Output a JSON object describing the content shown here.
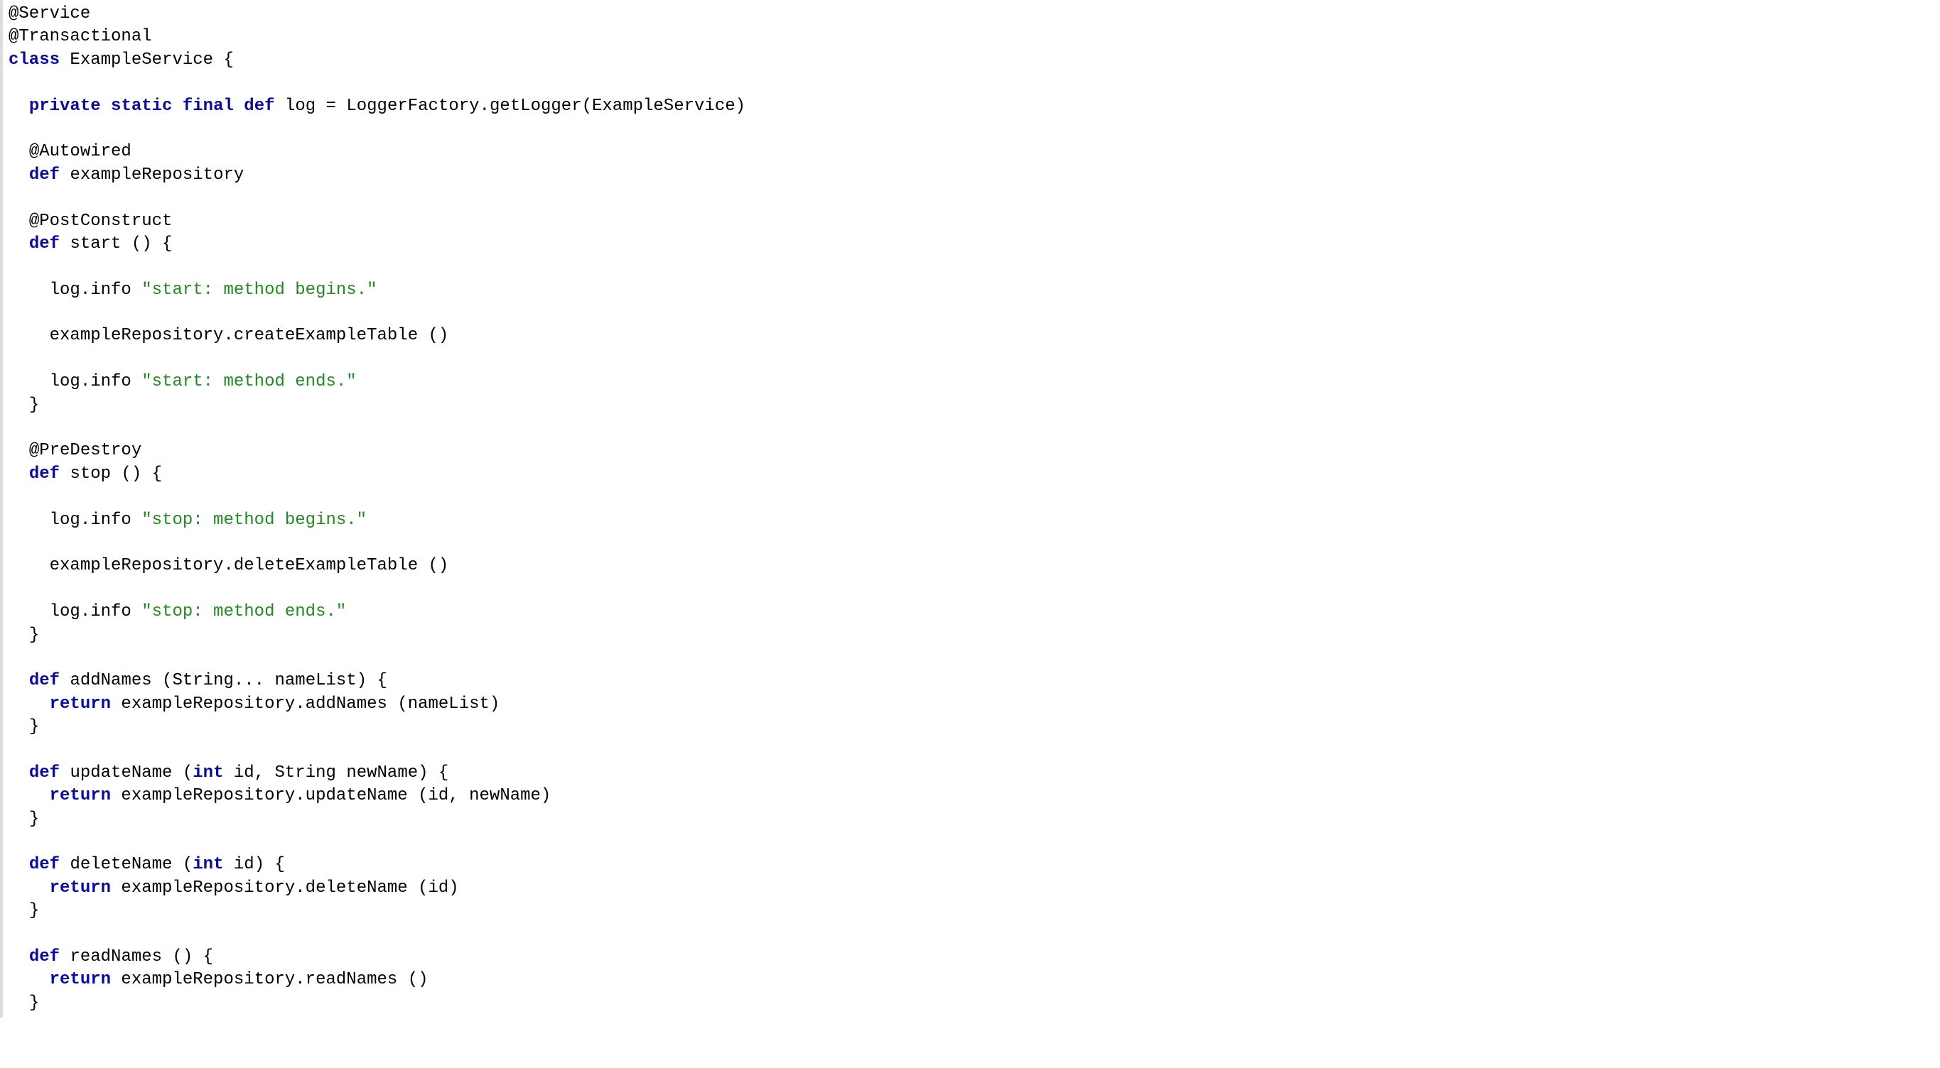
{
  "code": {
    "ann_service": "@Service",
    "ann_transactional": "@Transactional",
    "kw_class": "class",
    "class_name": "ExampleService",
    "open_brace": "{",
    "close_brace": "}",
    "kw_private": "private",
    "kw_static": "static",
    "kw_final": "final",
    "kw_def": "def",
    "kw_return": "return",
    "kw_int": "int",
    "log_decl": "log = LoggerFactory.getLogger(ExampleService)",
    "ann_autowired": "@Autowired",
    "repo_field": "exampleRepository",
    "ann_postconstruct": "@PostConstruct",
    "start_sig": "start () {",
    "start_log1_call": "log.info ",
    "start_log1_str": "\"start: method begins.\"",
    "start_body": "exampleRepository.createExampleTable ()",
    "start_log2_call": "log.info ",
    "start_log2_str": "\"start: method ends.\"",
    "ann_predestroy": "@PreDestroy",
    "stop_sig": "stop () {",
    "stop_log1_call": "log.info ",
    "stop_log1_str": "\"stop: method begins.\"",
    "stop_body": "exampleRepository.deleteExampleTable ()",
    "stop_log2_call": "log.info ",
    "stop_log2_str": "\"stop: method ends.\"",
    "addnames_sig": "addNames (String... nameList) {",
    "addnames_ret": " exampleRepository.addNames (nameList)",
    "updatename_pre": "updateName (",
    "updatename_mid": " id, String newName) {",
    "updatename_ret": " exampleRepository.updateName (id, newName)",
    "deletename_pre": "deleteName (",
    "deletename_mid": " id) {",
    "deletename_ret": " exampleRepository.deleteName (id)",
    "readnames_sig": "readNames () {",
    "readnames_ret": " exampleRepository.readNames ()"
  }
}
